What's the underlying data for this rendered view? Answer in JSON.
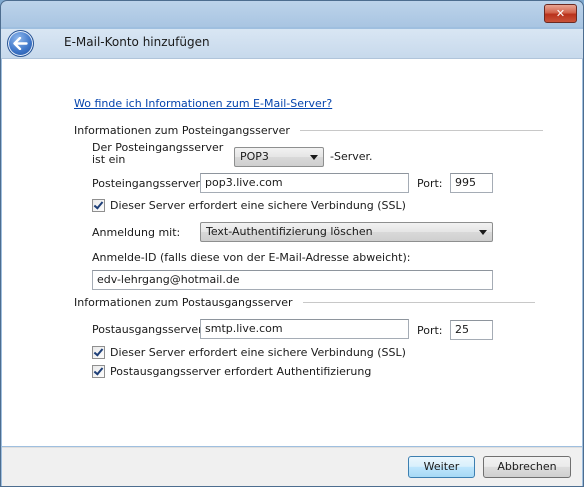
{
  "window": {
    "title": "E-Mail-Konto hinzufügen",
    "close_glyph": "✕"
  },
  "help_link": "Wo finde ich Informationen zum E-Mail-Server?",
  "incoming": {
    "section_title": "Informationen zum Posteingangsserver",
    "type_label": "Der Posteingangsserver ist ein",
    "server_type": "POP3",
    "type_suffix": "-Server.",
    "server_label": "Posteingangsserver:",
    "server_value": "pop3.live.com",
    "port_label": "Port:",
    "port_value": "995",
    "ssl_label": "Dieser Server erfordert eine sichere Verbindung (SSL)",
    "ssl_checked": true,
    "login_label": "Anmeldung mit:",
    "login_value": "Text-Authentifizierung löschen",
    "login_id_label": "Anmelde-ID (falls diese von der E-Mail-Adresse abweicht):",
    "login_id_value": "edv-lehrgang@hotmail.de"
  },
  "outgoing": {
    "section_title": "Informationen zum Postausgangsserver",
    "server_label": "Postausgangsserver:",
    "server_value": "smtp.live.com",
    "port_label": "Port:",
    "port_value": "25",
    "ssl_label": "Dieser Server erfordert eine sichere Verbindung (SSL)",
    "ssl_checked": true,
    "auth_label": "Postausgangsserver erfordert Authentifizierung",
    "auth_checked": true
  },
  "buttons": {
    "next": "Weiter",
    "cancel": "Abbrechen"
  },
  "icons": {
    "close": "close-icon",
    "back": "back-arrow-icon",
    "dropdown": "chevron-down-icon",
    "check": "checkmark-icon"
  },
  "colors": {
    "title_bar": "#a9c5e2",
    "link": "#0645ad",
    "close_button": "#c9533a",
    "back_button": "#3e76c9"
  }
}
